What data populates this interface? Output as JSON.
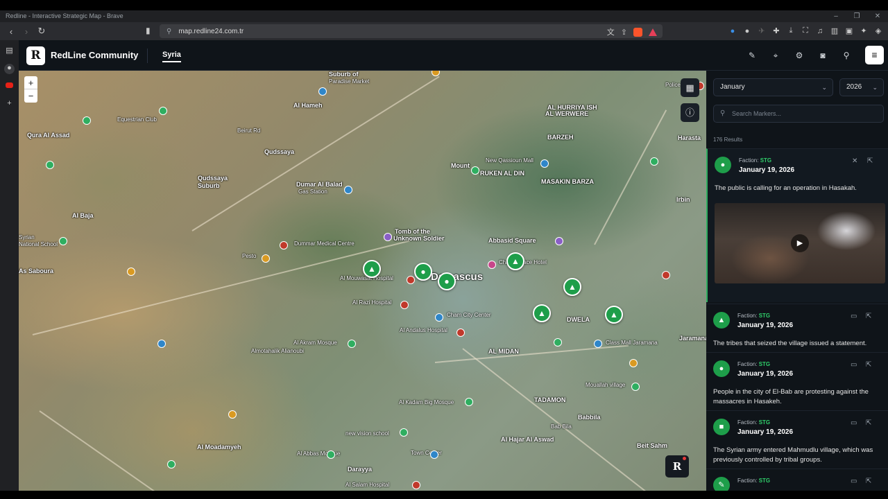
{
  "browser": {
    "window_title": "Redline - Interactive Strategic Map - Brave",
    "url": "map.redline24.com.tr"
  },
  "app": {
    "logo": "R",
    "title": "RedLine Community",
    "tab": "Syria"
  },
  "map": {
    "zoom_in": "+",
    "zoom_out": "−",
    "badge": "R",
    "labels": [
      {
        "text": "Suburb of",
        "cls": "bold"
      },
      {
        "text": "Paradise Market",
        "cls": ""
      },
      {
        "text": "Al Hameh",
        "cls": "bold"
      },
      {
        "text": "Qura Al Assad",
        "cls": "bold"
      },
      {
        "text": "Beirut Rd",
        "cls": ""
      },
      {
        "text": "Equestrian Club",
        "cls": ""
      },
      {
        "text": "BARZEH",
        "cls": "bold"
      },
      {
        "text": "AL HURRIYA ISH",
        "cls": "bold"
      },
      {
        "text": "AL WERWERE",
        "cls": "bold"
      },
      {
        "text": "Mount",
        "cls": "bold"
      },
      {
        "text": "New Qassioun Mall",
        "cls": ""
      },
      {
        "text": "RUKEN AL DIN",
        "cls": "bold"
      },
      {
        "text": "MASAKIN BARZA",
        "cls": "bold"
      },
      {
        "text": "Harasta",
        "cls": "bold"
      },
      {
        "text": "Qudssaya",
        "cls": "bold"
      },
      {
        "text": "Dumar Al Balad",
        "cls": "bold"
      },
      {
        "text": "Gas Station",
        "cls": ""
      },
      {
        "text": "Qudssaya",
        "cls": "bold"
      },
      {
        "text": "Suburb",
        "cls": "bold"
      },
      {
        "text": "Al Baja",
        "cls": "bold"
      },
      {
        "text": "Irbin",
        "cls": "bold"
      },
      {
        "text": "Tomb of the",
        "cls": "bold"
      },
      {
        "text": "Unknown Soldier",
        "cls": "bold"
      },
      {
        "text": "Dummar Medical Centre",
        "cls": ""
      },
      {
        "text": "Abbasid Square",
        "cls": "bold"
      },
      {
        "text": "Pesto",
        "cls": ""
      },
      {
        "text": "Damascus",
        "cls": "big"
      },
      {
        "text": "Cham Palace Hotel",
        "cls": ""
      },
      {
        "text": "Al Mouwasat Hospital",
        "cls": ""
      },
      {
        "text": "Al Razi Hospital",
        "cls": ""
      },
      {
        "text": "Cham City Center",
        "cls": ""
      },
      {
        "text": "Al Andalus Hospital",
        "cls": ""
      },
      {
        "text": "AL MIDAN",
        "cls": "bold"
      },
      {
        "text": "DWELA",
        "cls": "bold"
      },
      {
        "text": "Class Mall Jaramana",
        "cls": ""
      },
      {
        "text": "Al Akram Mosque",
        "cls": ""
      },
      {
        "text": "Almotahalik Alianoubi",
        "cls": ""
      },
      {
        "text": "Al Kadam Big Mosque",
        "cls": ""
      },
      {
        "text": "TADAMON",
        "cls": "bold"
      },
      {
        "text": "Mouallah village",
        "cls": ""
      },
      {
        "text": "Al Moadamyeh",
        "cls": "bold"
      },
      {
        "text": "new vision school",
        "cls": ""
      },
      {
        "text": "Town Center",
        "cls": ""
      },
      {
        "text": "Al Abbas Mosque",
        "cls": ""
      },
      {
        "text": "Babbila",
        "cls": "bold"
      },
      {
        "text": "Bab Bila",
        "cls": ""
      },
      {
        "text": "Al Hajar Al Aswad",
        "cls": "bold"
      },
      {
        "text": "Beit Sahm",
        "cls": "bold"
      },
      {
        "text": "Darayya",
        "cls": "bold"
      },
      {
        "text": "Al Salam Hospital",
        "cls": ""
      },
      {
        "text": "Police Hos",
        "cls": ""
      },
      {
        "text": "Jaramana",
        "cls": "bold"
      },
      {
        "text": "As Saboura",
        "cls": "bold"
      },
      {
        "text": "Syrian",
        "cls": ""
      },
      {
        "text": "National School",
        "cls": ""
      }
    ]
  },
  "panel": {
    "month": "January",
    "year": "2026",
    "search_placeholder": "Search Markers...",
    "results": "176 Results",
    "items": [
      {
        "faction_label": "Faction:",
        "faction": "STG",
        "date": "January 19, 2026",
        "text": "The public is calling for an operation in Hasakah."
      },
      {
        "faction_label": "Faction:",
        "faction": "STG",
        "date": "January 19, 2026",
        "text": "The tribes that seized the village issued a statement."
      },
      {
        "faction_label": "Faction:",
        "faction": "STG",
        "date": "January 19, 2026",
        "text": "People in the city of El-Bab are protesting against the massacres in Hasakeh."
      },
      {
        "faction_label": "Faction:",
        "faction": "STG",
        "date": "January 19, 2026",
        "text": "The Syrian army entered Mahmudlu village, which was previously controlled by tribal groups."
      },
      {
        "faction_label": "Faction:",
        "faction": "STG",
        "date": "",
        "text": ""
      }
    ]
  },
  "icons": {
    "back": "back-icon",
    "forward": "forward-icon",
    "reload": "reload-icon",
    "pen": "pen-icon",
    "pin": "location-pin-icon",
    "settings": "gear-icon",
    "camera": "camera-icon",
    "search": "search-icon",
    "menu": "hamburger-icon"
  },
  "colors": {
    "faction_green": "#1e9e4a",
    "header_bg": "#0f1419",
    "accent_green_text": "#2fcf6a"
  }
}
